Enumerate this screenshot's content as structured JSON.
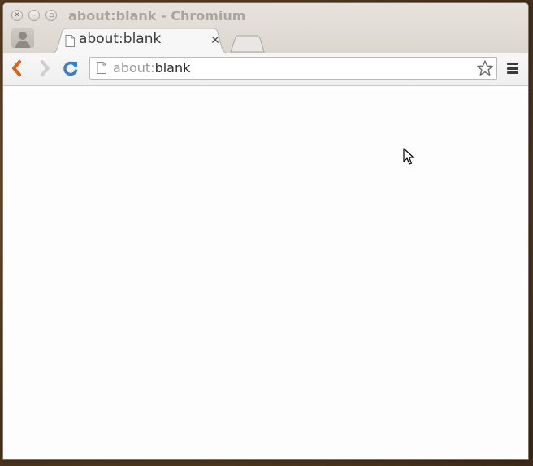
{
  "window": {
    "title": "about:blank - Chromium"
  },
  "tabs": [
    {
      "title": "about:blank",
      "active": true
    }
  ],
  "omnibox": {
    "scheme": "about:",
    "host": "blank"
  },
  "icons": {
    "back": "back-arrow-icon",
    "forward": "forward-arrow-icon",
    "reload": "reload-icon",
    "star": "star-icon",
    "menu": "hamburger-menu-icon",
    "page": "page-icon",
    "profile": "profile-icon"
  },
  "colors": {
    "back_arrow": "#d9601e",
    "reload": "#3d7ec6",
    "title_text": "#a9a49c"
  }
}
